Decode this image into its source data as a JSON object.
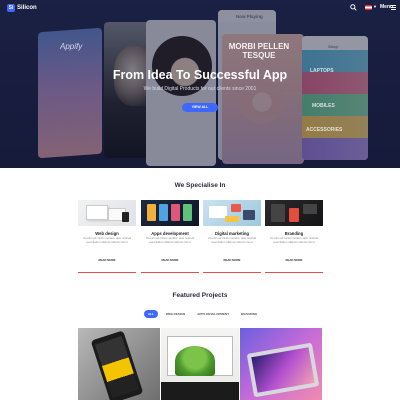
{
  "nav": {
    "logo_mark": "Si",
    "logo_text": "Silicon",
    "menu_label": "Menu"
  },
  "hero": {
    "screen_texts": {
      "appify": "Appify",
      "now_playing": "Now Playing",
      "morbi": "MORBI PELLEN TESQUE",
      "shop": "Shop",
      "laptops": "LAPTOPS",
      "mobiles": "MOBILES",
      "accessories": "ACCESSORIES"
    },
    "title": "From Idea To Successful App",
    "subtitle": "We build Digital Products for our clients since 2001",
    "button": "VIEW ALL"
  },
  "specialise": {
    "title": "We Specialise In",
    "cards": [
      {
        "title": "Web design",
        "text": "Ut enim ad minim veniam, quis nostrud exercitation ullamco laboris nisi ut",
        "link": "READ MORE"
      },
      {
        "title": "Apps development",
        "text": "Ut enim ad minim veniam, quis nostrud exercitation ullamco laboris nisi ut",
        "link": "READ MORE"
      },
      {
        "title": "Digital marketing",
        "text": "Ut enim ad minim veniam, quis nostrud exercitation ullamco laboris nisi ut",
        "link": "READ MORE"
      },
      {
        "title": "Branding",
        "text": "Ut enim ad minim veniam, quis nostrud exercitation ullamco laboris nisi ut",
        "link": "READ MORE"
      }
    ]
  },
  "featured": {
    "title": "Featured Projects",
    "filters": [
      "ALL",
      "WEB DESIGN",
      "APPS DEVELOPMENT",
      "BRANDING"
    ]
  },
  "colors": {
    "accent": "#3d67ff",
    "card_line": "#e84c4c",
    "hero_bg": "#1a1f40"
  }
}
